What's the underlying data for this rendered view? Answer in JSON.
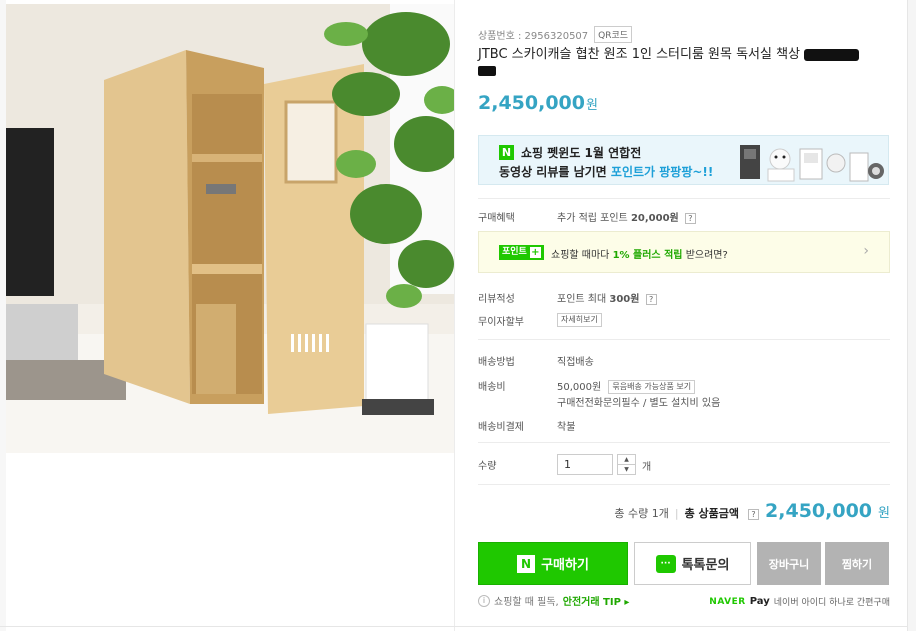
{
  "product": {
    "code_label": "상품번호 : 2956320507",
    "qr_label": "QR코드",
    "title": "JTBC 스카이캐슬 협찬 원조 1인 스터디룸 원목 독서실 책상",
    "price": "2,450,000",
    "currency": "원"
  },
  "banner": {
    "logo": "N",
    "line1": "쇼핑 펫윈도 1월 연합전",
    "line2_prefix": "동영상 리뷰를 남기면 ",
    "line2_highlight": "포인트가 팡팡팡~!!"
  },
  "benefits": {
    "label": "구매혜택",
    "text": "추가 적립 포인트 ",
    "points": "20,000원",
    "help": "?"
  },
  "point_box": {
    "badge": "포인트",
    "plus": "+",
    "text_prefix": "쇼핑할 때마다 ",
    "text_strong": "1% 플러스 적립",
    "text_suffix": " 받으려면?",
    "arrow": "›"
  },
  "review": {
    "label": "리뷰적성",
    "text": "포인트 최대 ",
    "points": "300원",
    "help": "?"
  },
  "installment": {
    "label": "무이자할부",
    "detail_button": "자세히보기"
  },
  "shipping": {
    "method_label": "배송방법",
    "method_value": "직접배송",
    "fee_label": "배송비",
    "fee_value": "50,000원",
    "bundle_button": "묶음배송 가능상품 보기",
    "fee_note": "구매전전화문의필수 / 별도 설치비 있음",
    "payment_label": "배송비결제",
    "payment_value": "착불"
  },
  "quantity": {
    "label": "수량",
    "value": "1",
    "up": "▲",
    "down": "▼",
    "unit": "개"
  },
  "total": {
    "count_text": "총 수량 1개",
    "sep": "|",
    "label": "총 상품금액",
    "help": "?",
    "amount": "2,450,000",
    "currency": "원"
  },
  "buttons": {
    "buy_logo": "N",
    "buy": "구매하기",
    "talk_icon": "···",
    "talk": "톡톡문의",
    "cart": "장바구니",
    "wish": "찜하기"
  },
  "footer": {
    "tip_icon": "i",
    "tip_text": "쇼핑할 때 필독,",
    "tip_link": "안전거래 TIP ▸",
    "naver": "NAVER",
    "pay": "Pay",
    "pay_text": "네이버 아이디 하나로 간편구매"
  },
  "colors": {
    "accent_price": "#35a4c3",
    "naver_green": "#1fc800",
    "disabled_gray": "#b3b3b3"
  }
}
